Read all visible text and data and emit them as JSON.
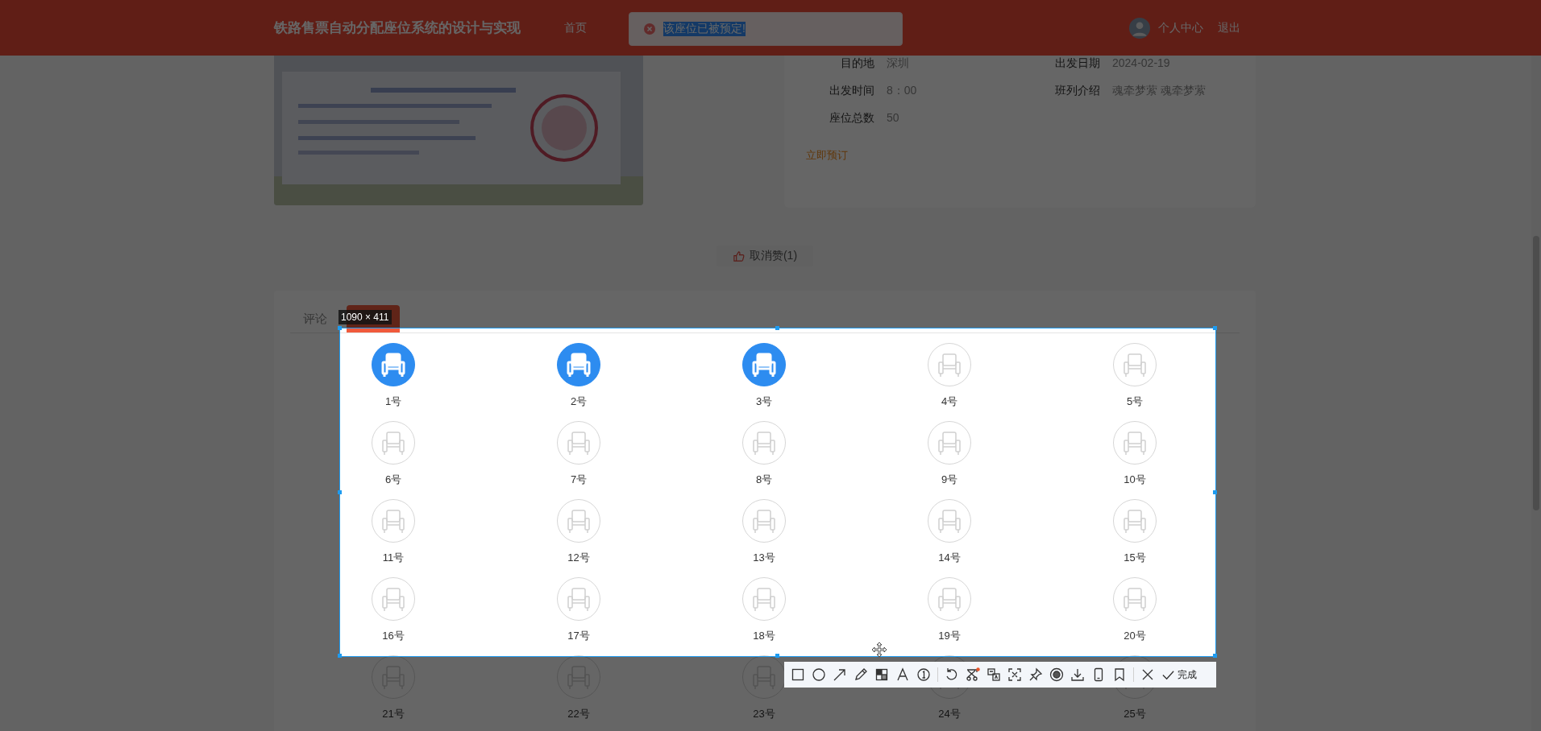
{
  "header": {
    "title": "铁路售票自动分配座位系统的设计与实现",
    "nav": [
      {
        "label": "首页"
      }
    ],
    "user_label": "个人中心",
    "logout": "退出"
  },
  "toast": {
    "kind": "error",
    "message": "该座位已被预定!",
    "highlighted": true
  },
  "train": {
    "fields": [
      {
        "label": "目的地",
        "value": "深圳"
      },
      {
        "label": "出发日期",
        "value": "2024-02-19"
      },
      {
        "label": "出发时间",
        "value": "8：00"
      },
      {
        "label": "班列介绍",
        "value": "魂牵梦萦 魂牵梦萦"
      },
      {
        "label": "座位总数",
        "value": "50"
      }
    ],
    "book_link": "立即预订"
  },
  "like_button": {
    "label": "取消赞(1)",
    "liked": true
  },
  "tabs": [
    {
      "label": "评论",
      "selected": false
    }
  ],
  "seats": [
    {
      "label": "1号",
      "selected": true
    },
    {
      "label": "2号",
      "selected": true
    },
    {
      "label": "3号",
      "selected": true
    },
    {
      "label": "4号",
      "selected": false
    },
    {
      "label": "5号",
      "selected": false
    },
    {
      "label": "6号",
      "selected": false
    },
    {
      "label": "7号",
      "selected": false
    },
    {
      "label": "8号",
      "selected": false
    },
    {
      "label": "9号",
      "selected": false
    },
    {
      "label": "10号",
      "selected": false
    },
    {
      "label": "11号",
      "selected": false
    },
    {
      "label": "12号",
      "selected": false
    },
    {
      "label": "13号",
      "selected": false
    },
    {
      "label": "14号",
      "selected": false
    },
    {
      "label": "15号",
      "selected": false
    },
    {
      "label": "16号",
      "selected": false
    },
    {
      "label": "17号",
      "selected": false
    },
    {
      "label": "18号",
      "selected": false
    },
    {
      "label": "19号",
      "selected": false
    },
    {
      "label": "20号",
      "selected": false
    },
    {
      "label": "21号",
      "selected": false
    },
    {
      "label": "22号",
      "selected": false
    },
    {
      "label": "23号",
      "selected": false
    },
    {
      "label": "24号",
      "selected": false
    },
    {
      "label": "25号",
      "selected": false
    }
  ],
  "capture": {
    "size_label": "1090 × 411",
    "done_label": "完成"
  }
}
